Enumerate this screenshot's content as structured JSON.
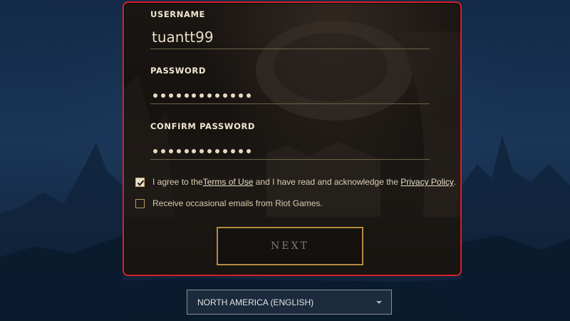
{
  "form": {
    "username_label": "USERNAME",
    "username_value": "tuantt99",
    "password_label": "PASSWORD",
    "password_mask_count": 13,
    "confirm_label": "CONFIRM PASSWORD",
    "confirm_mask_count": 13
  },
  "terms": {
    "checked": true,
    "text_before": "I agree to the ",
    "terms_link": "Terms of Use",
    "text_middle": " and I have read and acknowledge the ",
    "privacy_link": "Privacy Policy",
    "text_after": "."
  },
  "emails": {
    "checked": false,
    "text": "Receive occasional emails from Riot Games."
  },
  "next_button": {
    "label": "NEXT"
  },
  "region": {
    "selected": "NORTH AMERICA (ENGLISH)"
  },
  "colors": {
    "panel_border": "#d8202a",
    "gold_accent": "#b38b3f",
    "background": "#1a3556"
  }
}
